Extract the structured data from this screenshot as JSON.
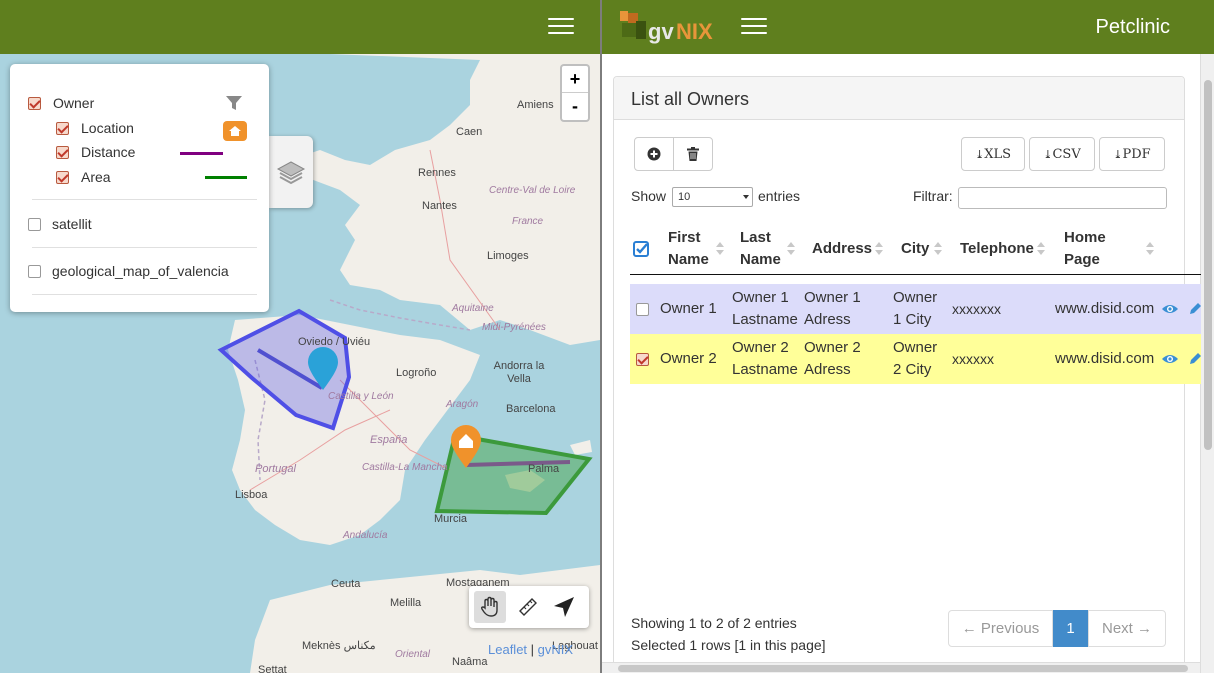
{
  "map": {
    "zoom_in_label": "+",
    "zoom_out_label": "-",
    "attribution_leaflet": "Leaflet",
    "attribution_sep": " | ",
    "attribution_gvnix": "gvNIX",
    "places": {
      "amiens": "Amiens",
      "caen": "Caen",
      "rennes": "Rennes",
      "nantes": "Nantes",
      "limoges": "Limoges",
      "oviedo": "Oviedo / Uviéu",
      "logrono": "Logroño",
      "andorra": "Andorra la Vella",
      "barcelona": "Barcelona",
      "palma": "Palma",
      "murcia": "Murcia",
      "lisboa": "Lisboa",
      "ceuta": "Ceuta",
      "melilla": "Melilla",
      "mostaganem": "Mostaganem",
      "meknes": "Meknès مكناس",
      "naama": "Naâma",
      "settat": "Settat",
      "laghouat": "Laghouat"
    },
    "regions": {
      "centre": "Centre-Val de Loire",
      "france": "France",
      "aquitaine": "Aquitaine",
      "midi": "Midi-Pyrénées",
      "castilla_leon": "Castilla y León",
      "aragon": "Aragón",
      "espana": "España",
      "portugal": "Portugal",
      "castilla_mancha": "Castilla-La Mancha",
      "andalucia": "Andalucía",
      "oriental": "Oriental"
    }
  },
  "legend": {
    "owner": "Owner",
    "location": "Location",
    "distance": "Distance",
    "area": "Area",
    "satellit": "satellit",
    "geological": "geological_map_of_valencia"
  },
  "header": {
    "brand": "Petclinic",
    "logo_text": "gvNIX"
  },
  "panel": {
    "title": "List all Owners",
    "export_xls": "XLS",
    "export_csv": "CSV",
    "export_pdf": "PDF",
    "show": "Show",
    "entries": "entries",
    "length_value": "10",
    "filter_label": "Filtrar:"
  },
  "table": {
    "columns": [
      {
        "l1": "First",
        "l2": "Name"
      },
      {
        "l1": "Last",
        "l2": "Name"
      },
      {
        "l1": "Address",
        "l2": ""
      },
      {
        "l1": "City",
        "l2": ""
      },
      {
        "l1": "Telephone",
        "l2": ""
      },
      {
        "l1": "Home",
        "l2": "Page"
      }
    ],
    "rows": [
      {
        "first": "Owner 1",
        "last1": "Owner 1",
        "last2": "Lastname",
        "addr1": "Owner 1",
        "addr2": "Adress",
        "city1": "Owner",
        "city2": "1 City",
        "tel": "xxxxxxx",
        "home": "www.disid.com",
        "selected": false
      },
      {
        "first": "Owner 2",
        "last1": "Owner 2",
        "last2": "Lastname",
        "addr1": "Owner 2",
        "addr2": "Adress",
        "city1": "Owner",
        "city2": "2 City",
        "tel": "xxxxxx",
        "home": "www.disid.com",
        "selected": true
      }
    ]
  },
  "footer": {
    "info": "Showing 1 to 2 of 2 entries",
    "selected": "Selected 1 rows [1 in this page]",
    "prev": "← Previous",
    "page": "1",
    "next": "Next →"
  },
  "colors": {
    "header_green": "#5f7f1e",
    "row1_bg": "#dcdcfa",
    "row2_bg": "#ffff99",
    "page_active": "#428bca",
    "distance_line": "#800080",
    "area_line": "#008000"
  }
}
